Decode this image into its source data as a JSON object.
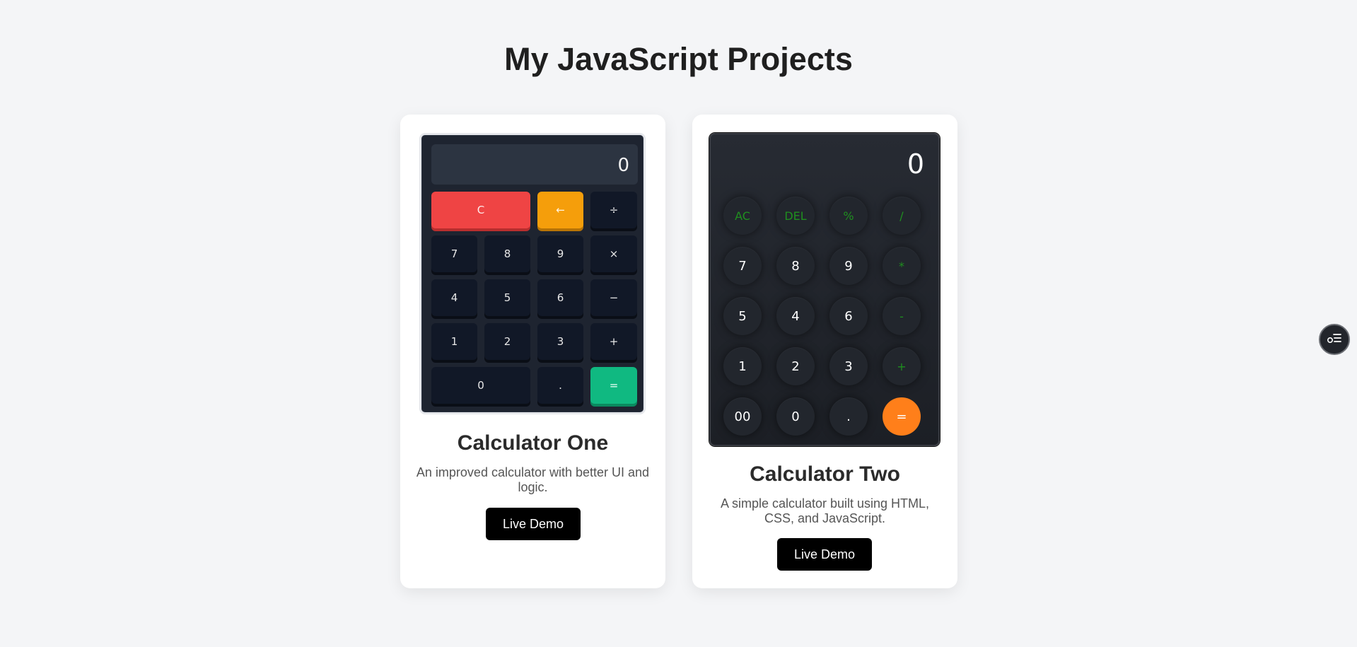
{
  "page": {
    "title": "My JavaScript Projects"
  },
  "projects": [
    {
      "title": "Calculator One",
      "description": "An improved calculator with better UI and logic.",
      "demo_label": "Live Demo",
      "calculator": {
        "display": "0",
        "keys": [
          "C",
          "←",
          "÷",
          "7",
          "8",
          "9",
          "×",
          "4",
          "5",
          "6",
          "−",
          "1",
          "2",
          "3",
          "+",
          "0",
          ".",
          "="
        ]
      }
    },
    {
      "title": "Calculator Two",
      "description": "A simple calculator built using HTML, CSS, and JavaScript.",
      "demo_label": "Live Demo",
      "calculator": {
        "display": "0",
        "keys": [
          "AC",
          "DEL",
          "%",
          "/",
          "7",
          "8",
          "9",
          "*",
          "5",
          "4",
          "6",
          "-",
          "1",
          "2",
          "3",
          "+",
          "00",
          "0",
          ".",
          "="
        ]
      }
    }
  ],
  "colors": {
    "clear": "#ef4444",
    "backspace": "#f59e0b",
    "equals_one": "#10b981",
    "equals_two": "#ff7f1a",
    "operator_two": "#1f8f1f"
  },
  "icons": {
    "side_button": "settings-list-icon"
  }
}
